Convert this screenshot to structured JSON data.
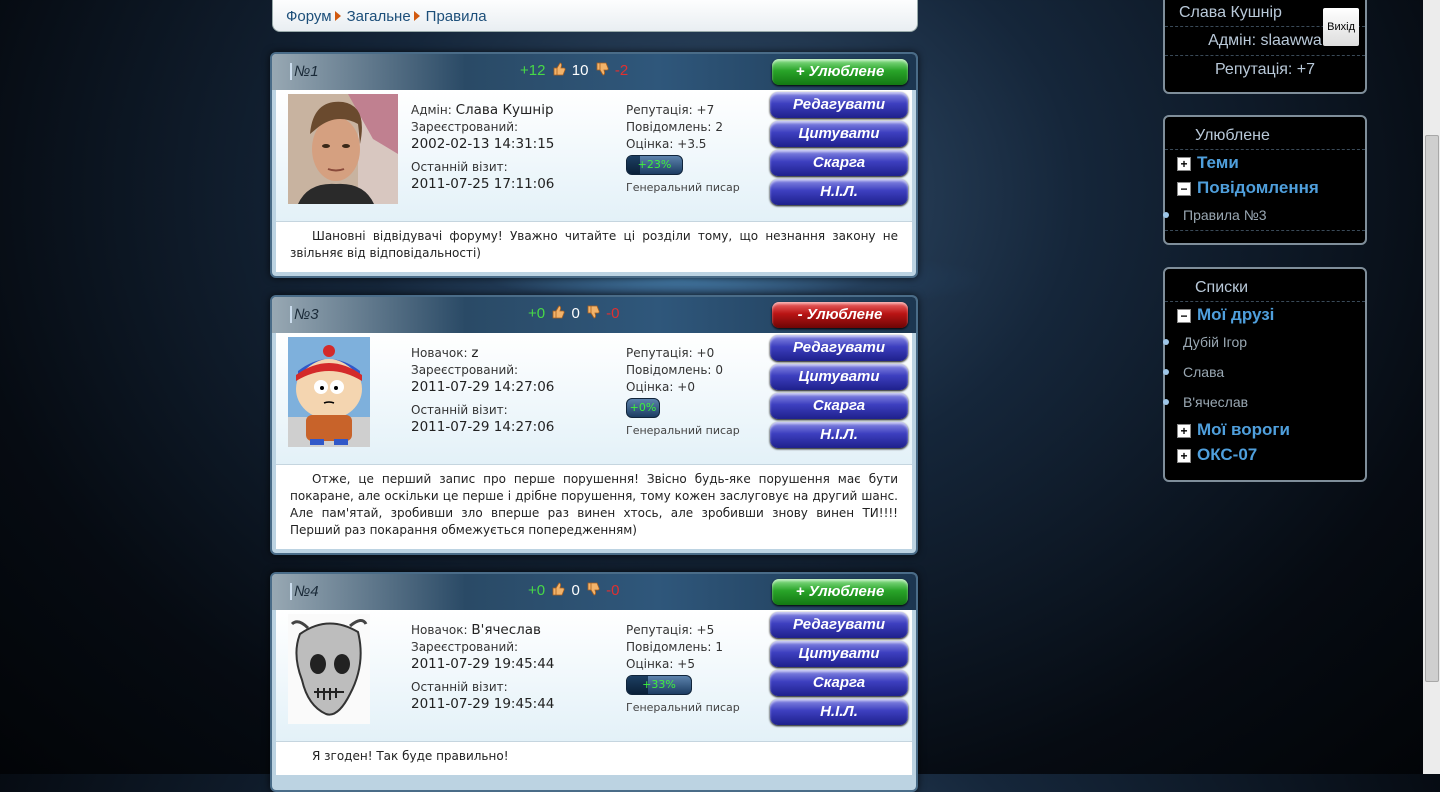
{
  "breadcrumb": [
    "Форум",
    "Загальне",
    "Правила"
  ],
  "posts": [
    {
      "number": "№1",
      "plus": "+12",
      "count": "10",
      "minus": "-2",
      "fav_label": "+  Улюблене",
      "fav_state": "add",
      "role": "Адмін:",
      "name": "Слава Кушнір",
      "registered_label": "Зареєстрований:",
      "registered": "2002-02-13 14:31:15",
      "visit_label": "Останній візит:",
      "visit": "2011-07-25 17:11:06",
      "rep_label": "Репутація:",
      "rep": "+7",
      "msgs_label": "Повідомлень:",
      "msgs": "2",
      "rating_label": "Оцінка:",
      "rating": "+3.5",
      "progress": "+23%",
      "progress_fraction": 0.23,
      "rank": "Генеральний писар",
      "text": "Шановні відвідувачі форуму! Уважно читайте ці розділи тому, що незнання закону не звільняє від відповідальності)"
    },
    {
      "number": "№3",
      "plus": "+0",
      "count": "0",
      "minus": "-0",
      "fav_label": "-  Улюблене",
      "fav_state": "remove",
      "role": "Новачок:",
      "name": "z",
      "registered_label": "Зареєстрований:",
      "registered": "2011-07-29 14:27:06",
      "visit_label": "Останній візит:",
      "visit": "2011-07-29 14:27:06",
      "rep_label": "Репутація:",
      "rep": "+0",
      "msgs_label": "Повідомлень:",
      "msgs": "0",
      "rating_label": "Оцінка:",
      "rating": "+0",
      "progress": "+0%",
      "progress_fraction": 0,
      "rank": "Генеральний писар",
      "text": "Отже, це перший запис про перше порушення! Звісно будь-яке порушення має бути покаране, але оскільки це перше і дрібне порушення, тому кожен заслуговує на другий шанс. Але пам'ятай, зробивши зло вперше раз винен хтось, але зробивши знову винен ТИ!!!! Перший раз покарання обмежується попередженням)"
    },
    {
      "number": "№4",
      "plus": "+0",
      "count": "0",
      "minus": "-0",
      "fav_label": "+  Улюблене",
      "fav_state": "add",
      "role": "Новачок:",
      "name": "В'ячеслав",
      "registered_label": "Зареєстрований:",
      "registered": "2011-07-29 19:45:44",
      "visit_label": "Останній візит:",
      "visit": "2011-07-29 19:45:44",
      "rep_label": "Репутація:",
      "rep": "+5",
      "msgs_label": "Повідомлень:",
      "msgs": "1",
      "rating_label": "Оцінка:",
      "rating": "+5",
      "progress": "+33%",
      "progress_fraction": 0.33,
      "rank": "Генеральний писар",
      "text": "Я згоден! Так буде правильно!"
    }
  ],
  "actions": [
    "Редагувати",
    "Цитувати",
    "Скарга",
    "Н.І.Л."
  ],
  "user_panel": {
    "name": "Слава Кушнір",
    "logout": "Вихід",
    "admin": "Адмін: slaawwa",
    "reputation": "Репутація: +7"
  },
  "favorites": {
    "title": "Улюблене",
    "topics": "Теми",
    "messages": "Повідомлення",
    "items": [
      "Правила №3"
    ]
  },
  "lists": {
    "title": "Списки",
    "friends": "Мої друзі",
    "friend_items": [
      "Дубій Ігор",
      "Слава",
      "В'ячеслав"
    ],
    "enemies": "Мої вороги",
    "oks": "ОКС-07"
  },
  "colors": {
    "plus": "#47d847",
    "minus": "#e03030",
    "link": "#1d4f7a",
    "tree": "#4f9fdc"
  }
}
